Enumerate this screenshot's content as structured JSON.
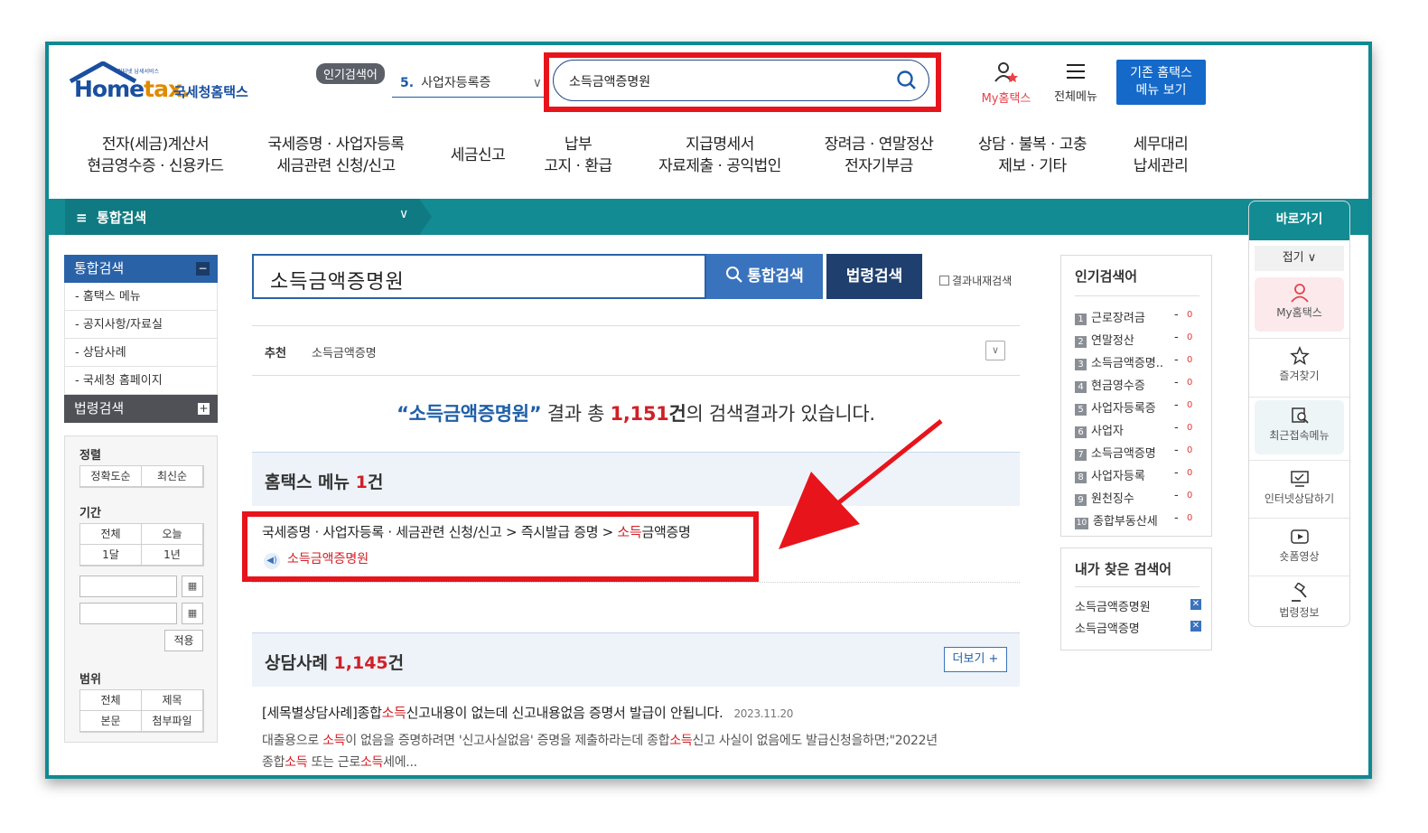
{
  "header": {
    "logo_brand_a": "Hom",
    "logo_brand_b": "e",
    "logo_brand_c": "tax.",
    "logo_korean": "국세청홈택스",
    "logo_tagline": "인터넷 납세서비스",
    "popular_badge": "인기검색어",
    "popular_num": "5.",
    "popular_term": "사업자등록증",
    "search_value": "소득금액증명원",
    "my_hometax": "My홈택스",
    "all_menu": "전체메뉴",
    "old_view_line1": "기존 홈택스",
    "old_view_line2": "메뉴 보기"
  },
  "main_nav": [
    {
      "l1": "전자(세금)계산서",
      "l2": "현금영수증 · 신용카드"
    },
    {
      "l1": "국세증명 · 사업자등록",
      "l2": "세금관련 신청/신고"
    },
    {
      "l1": "세금신고",
      "l2": ""
    },
    {
      "l1": "납부",
      "l2": "고지 · 환급"
    },
    {
      "l1": "지급명세서",
      "l2": "자료제출 · 공익법인"
    },
    {
      "l1": "장려금 · 연말정산",
      "l2": "전자기부금"
    },
    {
      "l1": "상담 · 불복 · 고충",
      "l2": "제보 · 기타"
    },
    {
      "l1": "세무대리",
      "l2": "납세관리"
    }
  ],
  "breadcrumb": {
    "icon": "≡",
    "title": "통합검색"
  },
  "left_menu": {
    "integrated": "통합검색",
    "items": [
      "- 홈택스 메뉴",
      "- 공지사항/자료실",
      "- 상담사례",
      "- 국세청 홈페이지"
    ],
    "law": "법령검색"
  },
  "filters": {
    "sort_label": "정렬",
    "sort_options": [
      "정확도순",
      "최신순"
    ],
    "period_label": "기간",
    "period_options": [
      "전체",
      "오늘",
      "1달",
      "1년"
    ],
    "apply": "적용",
    "scope_label": "범위",
    "scope_options": [
      "전체",
      "제목",
      "본문",
      "첨부파일"
    ]
  },
  "search": {
    "query": "소득금액증명원",
    "integrated_btn": "통합검색",
    "law_btn": "법령검색",
    "within_label": "결과내재검색"
  },
  "recommend": {
    "label": "추천",
    "value": "소득금액증명"
  },
  "summary": {
    "quote": "“소득금액증명원”",
    "pre": " 결과 총 ",
    "count": "1,151",
    "unit": "건",
    "post": "의 검색결과가 있습니다."
  },
  "menu_section": {
    "title": "홈택스 메뉴 ",
    "count": "1",
    "unit": "건",
    "path": "국세증명 · 사업자등록 · 세금관련 신청/신고 > 즉시발급 증명 > ",
    "path_hl": "소득",
    "path_rest": "금액증명",
    "link": "소득금액증명원"
  },
  "cases_section": {
    "title": "상담사례 ",
    "count": "1,145",
    "unit": "건",
    "more": "더보기 +",
    "item_title_a": "[세목별상담사례]종합",
    "item_title_hl": "소득",
    "item_title_b": "신고내용이 없는데 신고내용없음 증명서 발급이 안됩니다.",
    "item_date": "2023.11.20",
    "body_1": "대출용으로 ",
    "body_2": "소득",
    "body_3": "이 없음을 증명하려면 '신고사실없음' 증명을 제출하라는데 종합",
    "body_4": "소득",
    "body_5": "신고 사실이 없음에도 발급신청을하면;\"2022년",
    "body_6": "종합",
    "body_7": "소득",
    "body_8": " 또는 근로",
    "body_9": "소득",
    "body_10": "세에..."
  },
  "popular_box": {
    "title": "인기검색어",
    "items": [
      {
        "rank": "1",
        "term": "근로장려금",
        "change": "0"
      },
      {
        "rank": "2",
        "term": "연말정산",
        "change": "0"
      },
      {
        "rank": "3",
        "term": "소득금액증명..",
        "change": "0"
      },
      {
        "rank": "4",
        "term": "현금영수증",
        "change": "0"
      },
      {
        "rank": "5",
        "term": "사업자등록증",
        "change": "0"
      },
      {
        "rank": "6",
        "term": "사업자",
        "change": "0"
      },
      {
        "rank": "7",
        "term": "소득금액증명",
        "change": "0"
      },
      {
        "rank": "8",
        "term": "사업자등록",
        "change": "0"
      },
      {
        "rank": "9",
        "term": "원천징수",
        "change": "0"
      },
      {
        "rank": "10",
        "term": "종합부동산세",
        "change": "0"
      }
    ],
    "dash": "-"
  },
  "my_search": {
    "title": "내가 찾은 검색어",
    "items": [
      "소득금액증명원",
      "소득금액증명"
    ]
  },
  "quick": {
    "title": "바로가기",
    "fold": "접기 ∨",
    "items": [
      "My홈택스",
      "즐겨찾기",
      "최근접속메뉴",
      "인터넷상담하기",
      "숏폼영상",
      "법령정보"
    ]
  },
  "colors": {
    "teal": "#128b93",
    "blue": "#2a62a8",
    "red_highlight": "#e8141b",
    "accent_red": "#d21f26"
  }
}
